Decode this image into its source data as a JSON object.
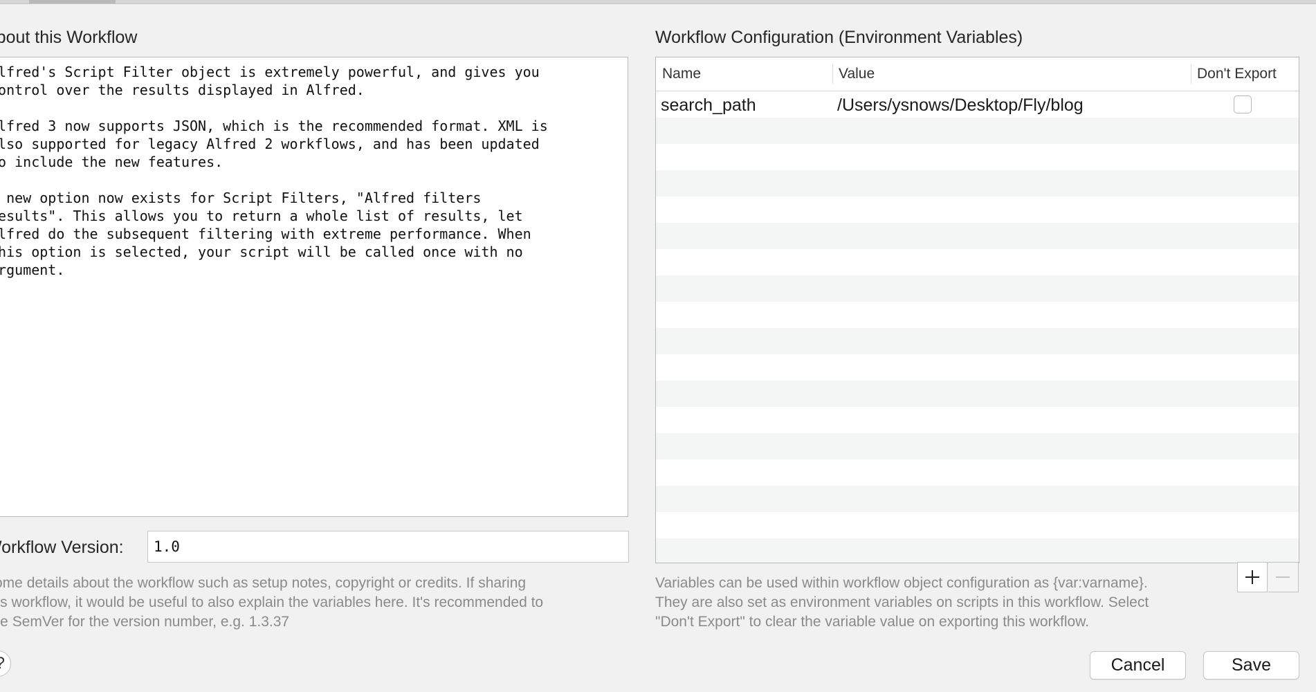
{
  "about": {
    "title": "About this Workflow",
    "text": "Alfred's Script Filter object is extremely powerful, and gives you\ncontrol over the results displayed in Alfred.\n\nAlfred 3 now supports JSON, which is the recommended format. XML is\nalso supported for legacy Alfred 2 workflows, and has been updated\nto include the new features.\n\nA new option now exists for Script Filters, \"Alfred filters\nresults\". This allows you to return a whole list of results, let\nAlfred do the subsequent filtering with extreme performance. When\nthis option is selected, your script will be called once with no\nargument."
  },
  "version": {
    "label": "Workflow Version:",
    "value": "1.0"
  },
  "help_note": "Some details about the workflow such as setup notes, copyright or credits. If sharing\nthis workflow, it would be useful to also explain the variables here. It's recommended to\nuse SemVer for the version number, e.g. 1.3.37",
  "help_button_label": "?",
  "config": {
    "title": "Workflow Configuration (Environment Variables)",
    "columns": [
      "Name",
      "Value",
      "Don't Export"
    ],
    "rows": [
      {
        "name": "search_path",
        "value": "/Users/ysnows/Desktop/Fly/blog",
        "dont_export": false
      }
    ],
    "note": "Variables can be used within workflow object configuration as {var:varname}.\nThey are also set as environment variables on scripts in this workflow. Select\n\"Don't Export\" to clear the variable value on exporting this workflow."
  },
  "icons": {
    "add": "plus-icon",
    "remove": "minus-icon"
  },
  "buttons": {
    "cancel": "Cancel",
    "save": "Save"
  }
}
